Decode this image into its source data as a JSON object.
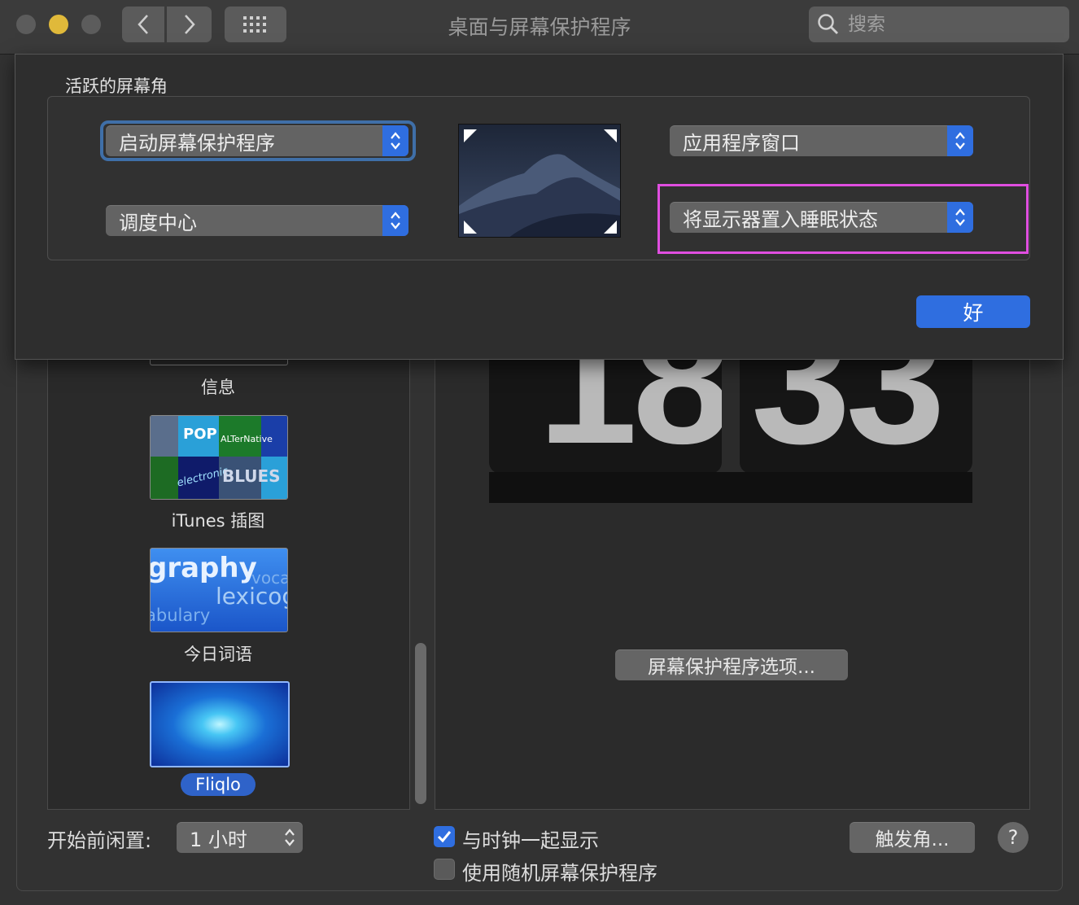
{
  "window": {
    "title": "桌面与屏幕保护程序",
    "search_placeholder": "搜索"
  },
  "screensavers": [
    {
      "label": "信息",
      "selected": false
    },
    {
      "label": "iTunes 插图",
      "selected": false
    },
    {
      "label": "今日词语",
      "selected": false,
      "thumb_words": [
        "graphy",
        "voca",
        "lexicog",
        "abulary"
      ]
    },
    {
      "label": "Fliqlo",
      "selected": true
    }
  ],
  "itunes_thumb_words": [
    "POP",
    "ALTerNative",
    "electronic",
    "BLUES"
  ],
  "clock": {
    "hours": "18",
    "minutes": "33"
  },
  "options_button": "屏幕保护程序选项...",
  "bottom": {
    "idle_label": "开始前闲置:",
    "idle_value": "1 小时",
    "show_clock_label": "与时钟一起显示",
    "show_clock_checked": true,
    "random_label": "使用随机屏幕保护程序",
    "random_checked": false,
    "hot_corners_button": "触发角...",
    "help_label": "?"
  },
  "sheet": {
    "title": "活跃的屏幕角",
    "top_left": "启动屏幕保护程序",
    "bottom_left": "调度中心",
    "top_right": "应用程序窗口",
    "bottom_right": "将显示器置入睡眠状态",
    "ok_button": "好"
  },
  "colors": {
    "accent": "#2f6ee0",
    "highlight": "#e04ee0",
    "window_bg": "#323232",
    "traffic_min": "#e0b93a"
  }
}
